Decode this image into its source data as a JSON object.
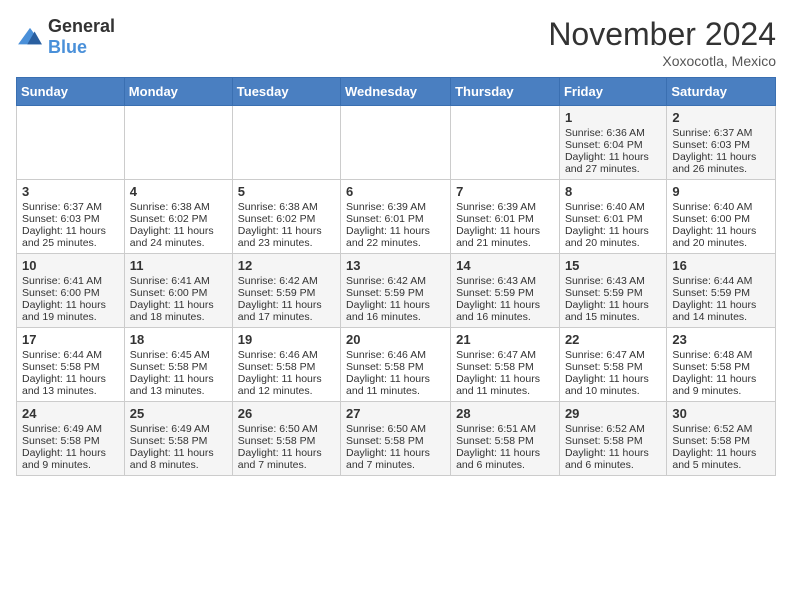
{
  "header": {
    "logo_general": "General",
    "logo_blue": "Blue",
    "title": "November 2024",
    "location": "Xoxocotla, Mexico"
  },
  "days_of_week": [
    "Sunday",
    "Monday",
    "Tuesday",
    "Wednesday",
    "Thursday",
    "Friday",
    "Saturday"
  ],
  "weeks": [
    [
      {
        "day": "",
        "info": ""
      },
      {
        "day": "",
        "info": ""
      },
      {
        "day": "",
        "info": ""
      },
      {
        "day": "",
        "info": ""
      },
      {
        "day": "",
        "info": ""
      },
      {
        "day": "1",
        "info": "Sunrise: 6:36 AM\nSunset: 6:04 PM\nDaylight: 11 hours and 27 minutes."
      },
      {
        "day": "2",
        "info": "Sunrise: 6:37 AM\nSunset: 6:03 PM\nDaylight: 11 hours and 26 minutes."
      }
    ],
    [
      {
        "day": "3",
        "info": "Sunrise: 6:37 AM\nSunset: 6:03 PM\nDaylight: 11 hours and 25 minutes."
      },
      {
        "day": "4",
        "info": "Sunrise: 6:38 AM\nSunset: 6:02 PM\nDaylight: 11 hours and 24 minutes."
      },
      {
        "day": "5",
        "info": "Sunrise: 6:38 AM\nSunset: 6:02 PM\nDaylight: 11 hours and 23 minutes."
      },
      {
        "day": "6",
        "info": "Sunrise: 6:39 AM\nSunset: 6:01 PM\nDaylight: 11 hours and 22 minutes."
      },
      {
        "day": "7",
        "info": "Sunrise: 6:39 AM\nSunset: 6:01 PM\nDaylight: 11 hours and 21 minutes."
      },
      {
        "day": "8",
        "info": "Sunrise: 6:40 AM\nSunset: 6:01 PM\nDaylight: 11 hours and 20 minutes."
      },
      {
        "day": "9",
        "info": "Sunrise: 6:40 AM\nSunset: 6:00 PM\nDaylight: 11 hours and 20 minutes."
      }
    ],
    [
      {
        "day": "10",
        "info": "Sunrise: 6:41 AM\nSunset: 6:00 PM\nDaylight: 11 hours and 19 minutes."
      },
      {
        "day": "11",
        "info": "Sunrise: 6:41 AM\nSunset: 6:00 PM\nDaylight: 11 hours and 18 minutes."
      },
      {
        "day": "12",
        "info": "Sunrise: 6:42 AM\nSunset: 5:59 PM\nDaylight: 11 hours and 17 minutes."
      },
      {
        "day": "13",
        "info": "Sunrise: 6:42 AM\nSunset: 5:59 PM\nDaylight: 11 hours and 16 minutes."
      },
      {
        "day": "14",
        "info": "Sunrise: 6:43 AM\nSunset: 5:59 PM\nDaylight: 11 hours and 16 minutes."
      },
      {
        "day": "15",
        "info": "Sunrise: 6:43 AM\nSunset: 5:59 PM\nDaylight: 11 hours and 15 minutes."
      },
      {
        "day": "16",
        "info": "Sunrise: 6:44 AM\nSunset: 5:59 PM\nDaylight: 11 hours and 14 minutes."
      }
    ],
    [
      {
        "day": "17",
        "info": "Sunrise: 6:44 AM\nSunset: 5:58 PM\nDaylight: 11 hours and 13 minutes."
      },
      {
        "day": "18",
        "info": "Sunrise: 6:45 AM\nSunset: 5:58 PM\nDaylight: 11 hours and 13 minutes."
      },
      {
        "day": "19",
        "info": "Sunrise: 6:46 AM\nSunset: 5:58 PM\nDaylight: 11 hours and 12 minutes."
      },
      {
        "day": "20",
        "info": "Sunrise: 6:46 AM\nSunset: 5:58 PM\nDaylight: 11 hours and 11 minutes."
      },
      {
        "day": "21",
        "info": "Sunrise: 6:47 AM\nSunset: 5:58 PM\nDaylight: 11 hours and 11 minutes."
      },
      {
        "day": "22",
        "info": "Sunrise: 6:47 AM\nSunset: 5:58 PM\nDaylight: 11 hours and 10 minutes."
      },
      {
        "day": "23",
        "info": "Sunrise: 6:48 AM\nSunset: 5:58 PM\nDaylight: 11 hours and 9 minutes."
      }
    ],
    [
      {
        "day": "24",
        "info": "Sunrise: 6:49 AM\nSunset: 5:58 PM\nDaylight: 11 hours and 9 minutes."
      },
      {
        "day": "25",
        "info": "Sunrise: 6:49 AM\nSunset: 5:58 PM\nDaylight: 11 hours and 8 minutes."
      },
      {
        "day": "26",
        "info": "Sunrise: 6:50 AM\nSunset: 5:58 PM\nDaylight: 11 hours and 7 minutes."
      },
      {
        "day": "27",
        "info": "Sunrise: 6:50 AM\nSunset: 5:58 PM\nDaylight: 11 hours and 7 minutes."
      },
      {
        "day": "28",
        "info": "Sunrise: 6:51 AM\nSunset: 5:58 PM\nDaylight: 11 hours and 6 minutes."
      },
      {
        "day": "29",
        "info": "Sunrise: 6:52 AM\nSunset: 5:58 PM\nDaylight: 11 hours and 6 minutes."
      },
      {
        "day": "30",
        "info": "Sunrise: 6:52 AM\nSunset: 5:58 PM\nDaylight: 11 hours and 5 minutes."
      }
    ]
  ]
}
